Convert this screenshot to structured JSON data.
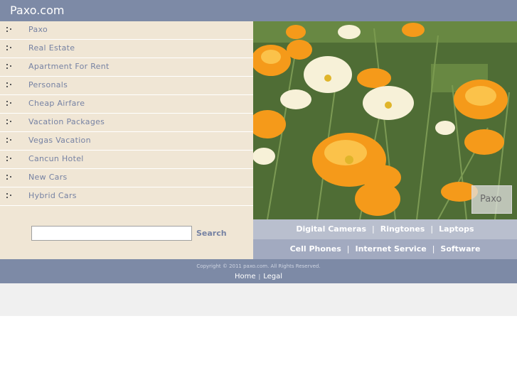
{
  "header": {
    "title": "Paxo.com"
  },
  "nav": {
    "items": [
      {
        "label": "Paxo"
      },
      {
        "label": "Real Estate"
      },
      {
        "label": "Apartment For Rent"
      },
      {
        "label": "Personals"
      },
      {
        "label": "Cheap Airfare"
      },
      {
        "label": "Vacation Packages"
      },
      {
        "label": "Vegas Vacation"
      },
      {
        "label": "Cancun Hotel"
      },
      {
        "label": "New Cars"
      },
      {
        "label": "Hybrid Cars"
      }
    ]
  },
  "search": {
    "value": "",
    "button_label": "Search"
  },
  "photo": {
    "badge": "Paxo"
  },
  "links": {
    "row1": [
      "Digital Cameras",
      "Ringtones",
      "Laptops"
    ],
    "row2": [
      "Cell Phones",
      "Internet Service",
      "Software"
    ],
    "separator": "|"
  },
  "footer": {
    "copyright": "Copyright © 2011 paxo.com. All Rights Reserved.",
    "home": "Home",
    "separator": "|",
    "legal": "Legal"
  },
  "colors": {
    "header_bg": "#7d8aa6",
    "sidebar_bg": "#f0e6d5",
    "link_color": "#7682a3",
    "links_row1_bg": "#b9bfce",
    "links_row2_bg": "#a2aac0"
  }
}
